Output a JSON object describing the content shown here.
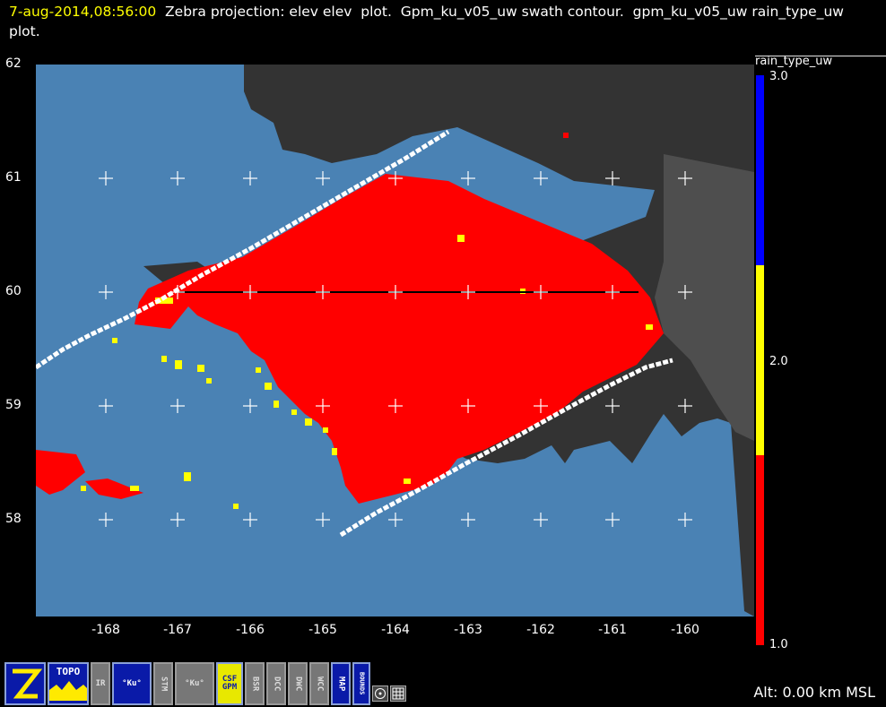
{
  "header": {
    "timestamp": "7-aug-2014,08:56:00",
    "description": "  Zebra projection: elev elev  plot.  Gpm_ku_v05_uw swath contour.  gpm_ku_v05_uw rain_type_uw  plot."
  },
  "map": {
    "lat_labels": [
      "62",
      "61",
      "60",
      "59",
      "58"
    ],
    "lon_labels": [
      "-168",
      "-167",
      "-166",
      "-165",
      "-164",
      "-163",
      "-162",
      "-161",
      "-160"
    ],
    "colors": {
      "ocean": "#4a82b4",
      "land": "#333333",
      "land_high": "#505050",
      "stratiform": "#ff0000",
      "convective": "#ffff00",
      "other": "#0000ff",
      "swath_edge": "#ffffff"
    }
  },
  "colorbar": {
    "title": "rain_type_uw",
    "tick_labels": [
      "3.0",
      "2.0",
      "1.0"
    ],
    "colors": [
      "#0000ff",
      "#ffff00",
      "#ff0000"
    ]
  },
  "toolbar": {
    "icons": [
      "zebra-logo-icon",
      "topo-icon",
      "ir-satellite-icon",
      "ku-swath-icon",
      "stm-icon",
      "ku-rain-icon",
      "csf-gpm-icon",
      "bsr-icon",
      "dcc-icon",
      "dwc-icon",
      "wcc-icon",
      "map-icon",
      "bounds-icon",
      "target-icon",
      "grid-icon"
    ],
    "labels": {
      "topo": "TOPO",
      "stm": "STM",
      "csf": "CSF GPM",
      "bsr": "BSR",
      "dcc": "DCC",
      "dwc": "DWC",
      "wcc": "WCC",
      "map": "MAP",
      "bounds": "BOUNDS",
      "ku": "°Ku°",
      "ir": "IR"
    }
  },
  "status": {
    "altitude": "Alt: 0.00 km MSL"
  }
}
